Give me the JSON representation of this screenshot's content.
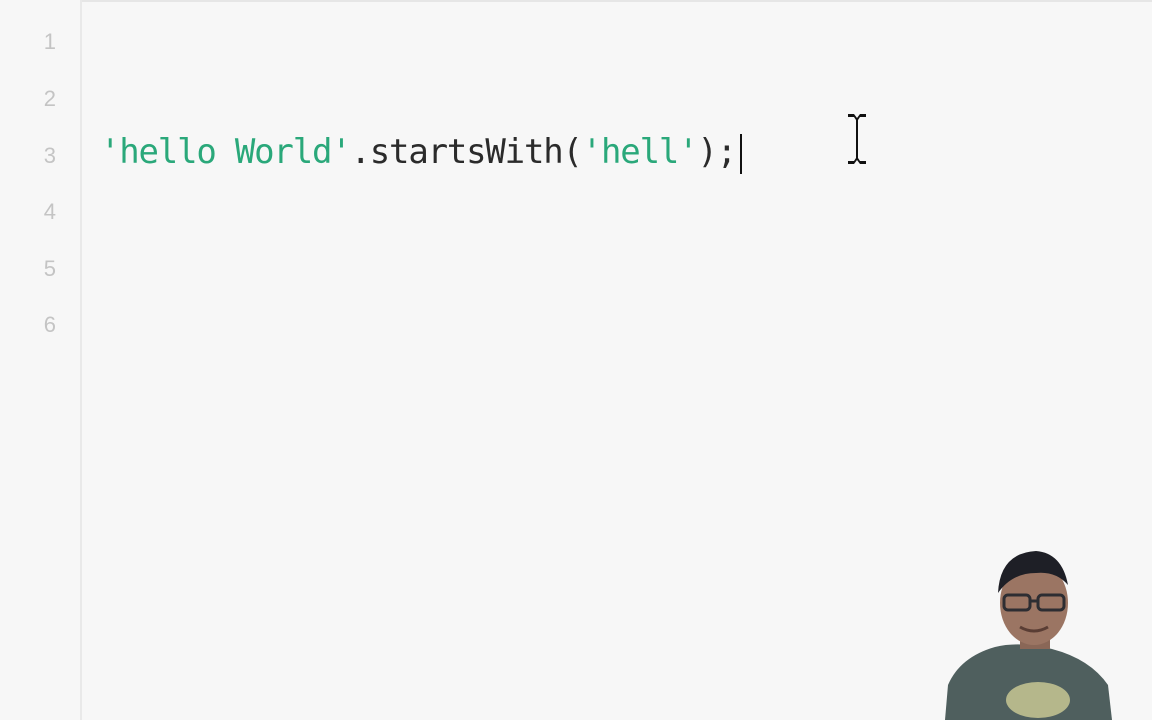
{
  "editor": {
    "line_numbers": [
      "1",
      "2",
      "3",
      "4",
      "5",
      "6"
    ],
    "code": {
      "line3": {
        "string1": "'hello World'",
        "method_call": ".startsWith(",
        "string2": "'hell'",
        "terminator": ");"
      }
    }
  },
  "colors": {
    "string": "#2aa87a",
    "plain": "#2b2b2b",
    "line_number": "#c4c4c4",
    "background": "#f7f7f7"
  },
  "icons": {
    "cursor": "text-cursor-ibeam-icon"
  }
}
